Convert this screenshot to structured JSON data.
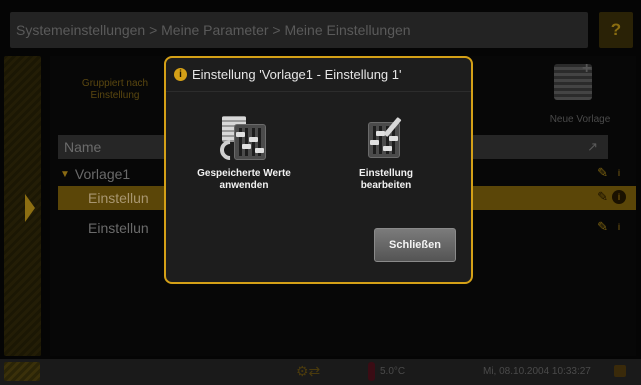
{
  "header": {
    "breadcrumb": "Systemeinstellungen > Meine Parameter > Meine Einstellungen",
    "help_label": "?"
  },
  "toolbar": {
    "group_label": "Gruppiert nach Einstellung",
    "new_template_label": "Neue Vorlage"
  },
  "table": {
    "column_name": "Name",
    "rows": [
      {
        "label": "Vorlage1",
        "type": "parent"
      },
      {
        "label": "Einstellun",
        "type": "child",
        "selected": true
      },
      {
        "label": "Einstellun",
        "type": "child",
        "selected": false
      }
    ]
  },
  "statusbar": {
    "temperature": "5.0°C",
    "datetime": "Mi, 08.10.2004 10:33:27"
  },
  "dialog": {
    "title": "Einstellung 'Vorlage1 - Einstellung 1'",
    "actions": [
      {
        "label": "Gespeicherte Werte anwenden",
        "icon": "apply-saved-values-icon"
      },
      {
        "label": "Einstellung bearbeiten",
        "icon": "edit-setting-icon"
      }
    ],
    "close_label": "Schließen"
  },
  "colors": {
    "accent": "#d4a017",
    "selected_row": "#5b4608",
    "dialog_bg": "#1d1d1d"
  }
}
